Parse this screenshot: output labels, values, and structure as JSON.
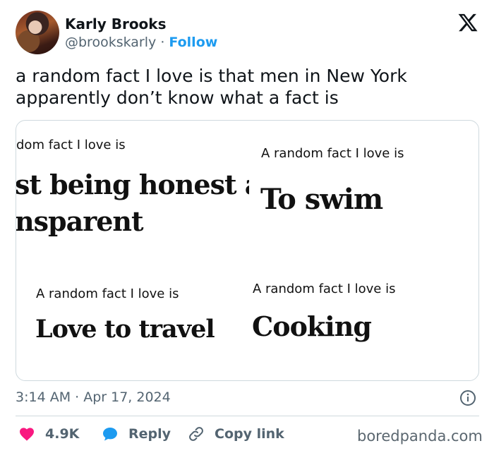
{
  "author": {
    "name": "Karly Brooks",
    "handle": "@brookskarly",
    "separator": "·",
    "follow_label": "Follow"
  },
  "tweet": {
    "line1": "a random fact I love is that men in New York",
    "line2": "apparently don’t know what a fact is"
  },
  "media": {
    "panel1": {
      "small": "dom fact I love is",
      "big1": "st being honest an",
      "big2": "nsparent"
    },
    "panel2": {
      "small": "A random fact I love is",
      "big": "To swim"
    },
    "panel3": {
      "small": "A random fact I love is",
      "big": "Love to travel"
    },
    "panel4": {
      "small": "A random fact I love is",
      "big": "Cooking"
    }
  },
  "meta": {
    "timestamp": "3:14 AM · Apr 17, 2024"
  },
  "actions": {
    "likes": "4.9K",
    "reply_label": "Reply",
    "copy_label": "Copy link"
  },
  "watermark": "boredpanda.com",
  "colors": {
    "accent": "#1d9bf0",
    "like": "#f91880",
    "muted": "#536471",
    "text": "#0f1419"
  },
  "icons": [
    "x-logo-icon",
    "info-icon",
    "heart-icon",
    "reply-bubble-icon",
    "link-icon"
  ]
}
